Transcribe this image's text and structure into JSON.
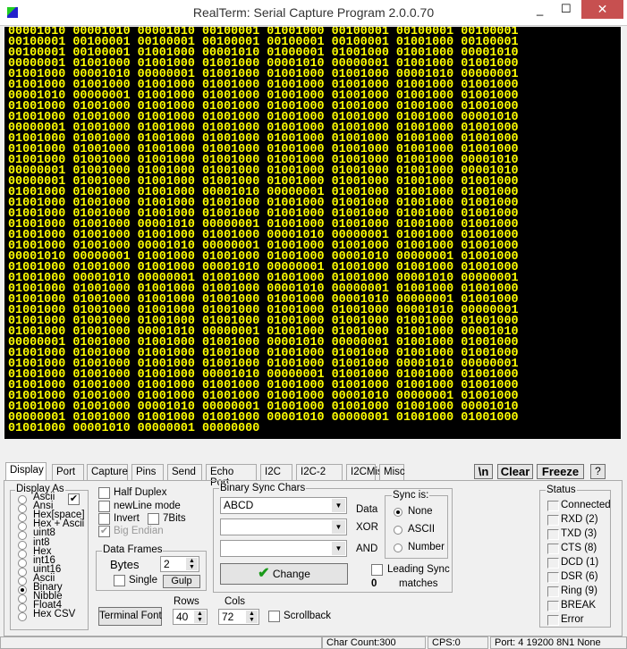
{
  "window": {
    "title": "RealTerm: Serial Capture Program 2.0.0.70",
    "minimize": "_",
    "maximize": "☐",
    "close": "✕"
  },
  "terminal": {
    "lines": [
      "00001010 00001010 00001010 00100001 01001000 00100001 00100001 00100001",
      "00100001 00100001 00100001 00100001 00100001 00100001 01001000 00100001",
      "00100001 00100001 01001000 00001010 01000001 01001000 01001000 00001010",
      "00000001 01001000 01001000 01001000 00001010 00000001 01001000 01001000",
      "01001000 00001010 00000001 01001000 01001000 01001000 00001010 00000001",
      "01001000 01001000 01001000 01001000 01001000 01001000 01001000 01001000",
      "00001010 00000001 01001000 01001000 01001000 01001000 01001000 01001000",
      "01001000 01001000 01001000 01001000 01001000 01001000 01001000 01001000",
      "01001000 01001000 01001000 01001000 01001000 01001000 01001000 00001010",
      "00000001 01001000 01001000 01001000 01001000 01001000 01001000 01001000",
      "01001000 01001000 01001000 01001000 01001000 01001000 01001000 01001000",
      "01001000 01001000 01001000 01001000 01001000 01001000 01001000 01001000",
      "01001000 01001000 01001000 01001000 01001000 01001000 01001000 00001010",
      "00000001 01001000 01001000 01001000 01001000 01001000 01001000 00001010",
      "00000001 01001000 01001000 01001000 01001000 01001000 01001000 01001000",
      "01001000 01001000 01001000 00001010 00000001 01001000 01001000 01001000",
      "01001000 01001000 01001000 01001000 01001000 01001000 01001000 01001000",
      "01001000 01001000 01001000 01001000 01001000 01001000 01001000 01001000",
      "01001000 01001000 00001010 00000001 01001000 01001000 01001000 01001000",
      "01001000 01001000 01001000 01001000 00001010 00000001 01001000 01001000",
      "01001000 01001000 00001010 00000001 01001000 01001000 01001000 01001000",
      "00001010 00000001 01001000 01001000 01001000 00001010 00000001 01001000",
      "01001000 01001000 01001000 00001010 00000001 01001000 01001000 01001000",
      "01001000 00001010 00000001 01001000 01001000 01001000 00001010 00000001",
      "01001000 01001000 01001000 01001000 00001010 00000001 01001000 01001000",
      "01001000 01001000 01001000 01001000 01001000 00001010 00000001 01001000",
      "01001000 01001000 01001000 01001000 01001000 01001000 00001010 00000001",
      "01001000 01001000 01001000 01001000 01001000 01001000 01001000 01001000",
      "01001000 01001000 00001010 00000001 01001000 01001000 01001000 00001010",
      "00000001 01001000 01001000 01001000 00001010 00000001 01001000 01001000",
      "01001000 01001000 01001000 01001000 01001000 01001000 01001000 01001000",
      "01001000 01001000 01001000 01001000 01001000 01001000 00001010 00000001",
      "01001000 01001000 01001000 00001010 00000001 01001000 01001000 01001000",
      "01001000 01001000 01001000 01001000 01001000 01001000 01001000 01001000",
      "01001000 01001000 01001000 01001000 01001000 00001010 00000001 01001000",
      "01001000 01001000 00001010 00000001 01001000 01001000 01001000 00001010",
      "00000001 01001000 01001000 01001000 00001010 00000001 01001000 01001000",
      "01001000 00001010 00000001 00000000"
    ]
  },
  "tabs": [
    "Display",
    "Port",
    "Capture",
    "Pins",
    "Send",
    "Echo Port",
    "I2C",
    "I2C-2",
    "I2CMisc",
    "Misc"
  ],
  "toolbar": {
    "newline": "\\n",
    "clear": "Clear",
    "freeze": "Freeze",
    "help": "?"
  },
  "display_as": {
    "title": "Display As",
    "options": [
      "Ascii",
      "Ansi",
      "Hex[space]",
      "Hex + Ascii",
      "uint8",
      "int8",
      "Hex",
      "int16",
      "uint16",
      "Ascii",
      "Binary",
      "Nibble",
      "Float4",
      "Hex CSV"
    ],
    "selected": "Binary"
  },
  "options": {
    "half_duplex": "Half Duplex",
    "newline_mode": "newLine mode",
    "invert": "Invert",
    "bits7": "7Bits",
    "big_endian": "Big Endian"
  },
  "data_frames": {
    "title": "Data Frames",
    "bytes_label": "Bytes",
    "bytes_value": "2",
    "single": "Single",
    "gulp": "Gulp"
  },
  "terminal_font": "Terminal Font",
  "rows": {
    "label": "Rows",
    "value": "40"
  },
  "cols": {
    "label": "Cols",
    "value": "72"
  },
  "scrollback": "Scrollback",
  "sync": {
    "title": "Binary Sync Chars",
    "data_value": "ABCD",
    "data_label": "Data",
    "xor_label": "XOR",
    "and_label": "AND",
    "change": "Change",
    "sync_is": "Sync is:",
    "sync_options": [
      "None",
      "ASCII",
      "Number"
    ],
    "leading": "Leading Sync",
    "count": "0",
    "matches": "matches"
  },
  "status": {
    "title": "Status",
    "items": [
      "Connected",
      "RXD (2)",
      "TXD (3)",
      "CTS (8)",
      "DCD (1)",
      "DSR (6)",
      "Ring (9)",
      "BREAK",
      "Error"
    ]
  },
  "statusbar": {
    "char_count": "Char Count:300",
    "cps": "CPS:0",
    "port": "Port: 4 19200 8N1 None"
  }
}
